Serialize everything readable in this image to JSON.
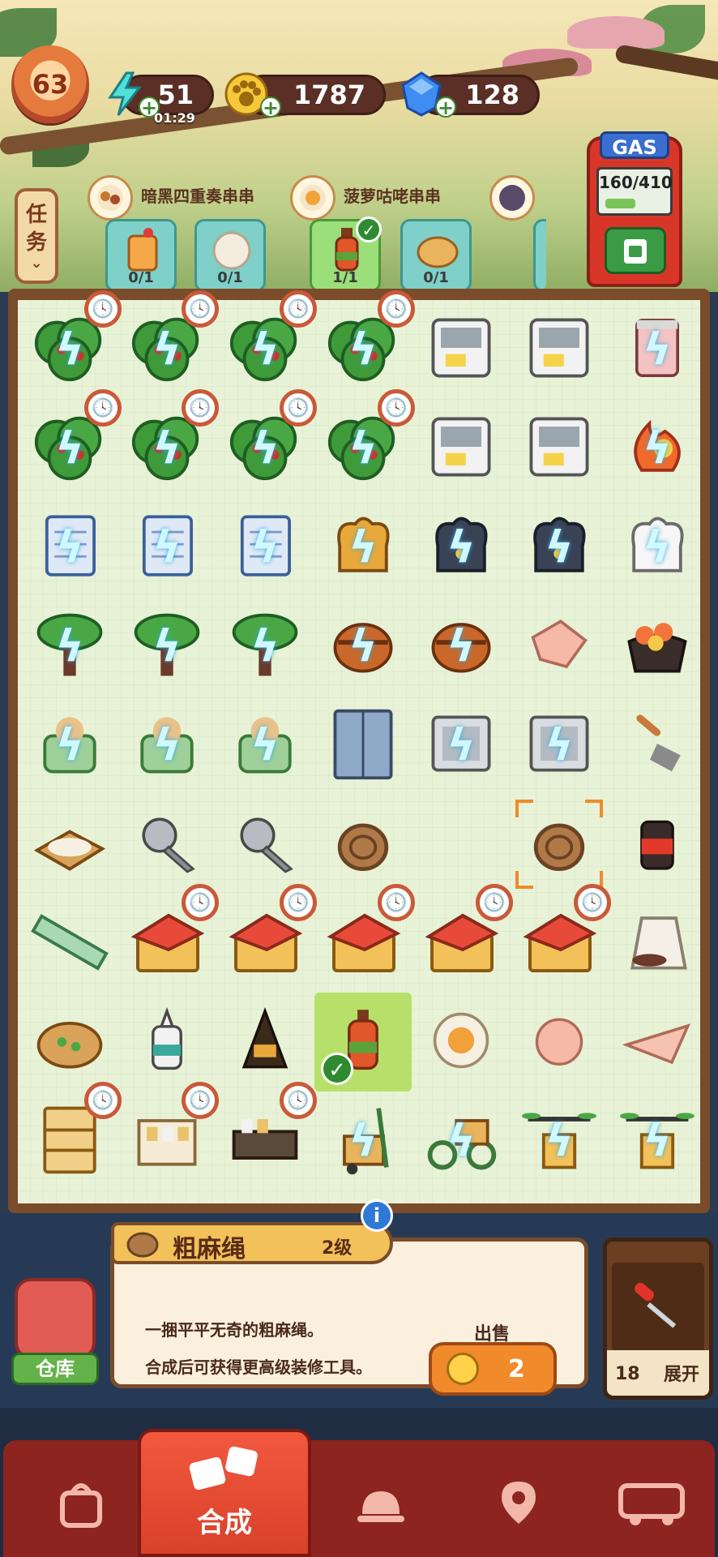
{
  "header": {
    "level": "63",
    "energy": "51",
    "energy_timer": "01:29",
    "coins": "1787",
    "gems": "128",
    "plus_symbol": "+"
  },
  "gas": {
    "label": "GAS",
    "reading": "160/410",
    "fill_fraction": 0.39
  },
  "tasks": {
    "tab_label_1": "任",
    "tab_label_2": "务",
    "orders": [
      {
        "title": "暗黑四重奏串串",
        "items": [
          {
            "count": "0/1"
          },
          {
            "count": "0/1"
          }
        ]
      },
      {
        "title": "菠萝咕咾串串",
        "items": [
          {
            "count": "1/1"
          },
          {
            "count": "0/1"
          }
        ]
      },
      {
        "title": "",
        "items": []
      }
    ]
  },
  "board": {
    "bolt_symbol": "ϟ",
    "clock_symbol": "🕓",
    "check_symbol": "✓"
  },
  "info": {
    "item_name": "粗麻绳",
    "item_level": "2级",
    "info_symbol": "i",
    "desc_line1": "一捆平平无奇的粗麻绳。",
    "desc_line2": "合成后可获得更高级装修工具。",
    "sell_label": "出售",
    "sell_price": "2",
    "warehouse_label": "仓库",
    "toolbox_count": "18",
    "toolbox_expand": "展开"
  },
  "nav": {
    "active_label": "合成",
    "items": [
      "shop-bag-icon",
      "merge-icon",
      "service-bell-icon",
      "map-pin-icon",
      "bus-icon"
    ]
  },
  "colors": {
    "board_bg": "#e8f2d7",
    "frame": "#7a4c2a",
    "nav_bar": "#8e2420",
    "nav_active": "#e04a32",
    "accent_orange": "#f08a2a"
  }
}
